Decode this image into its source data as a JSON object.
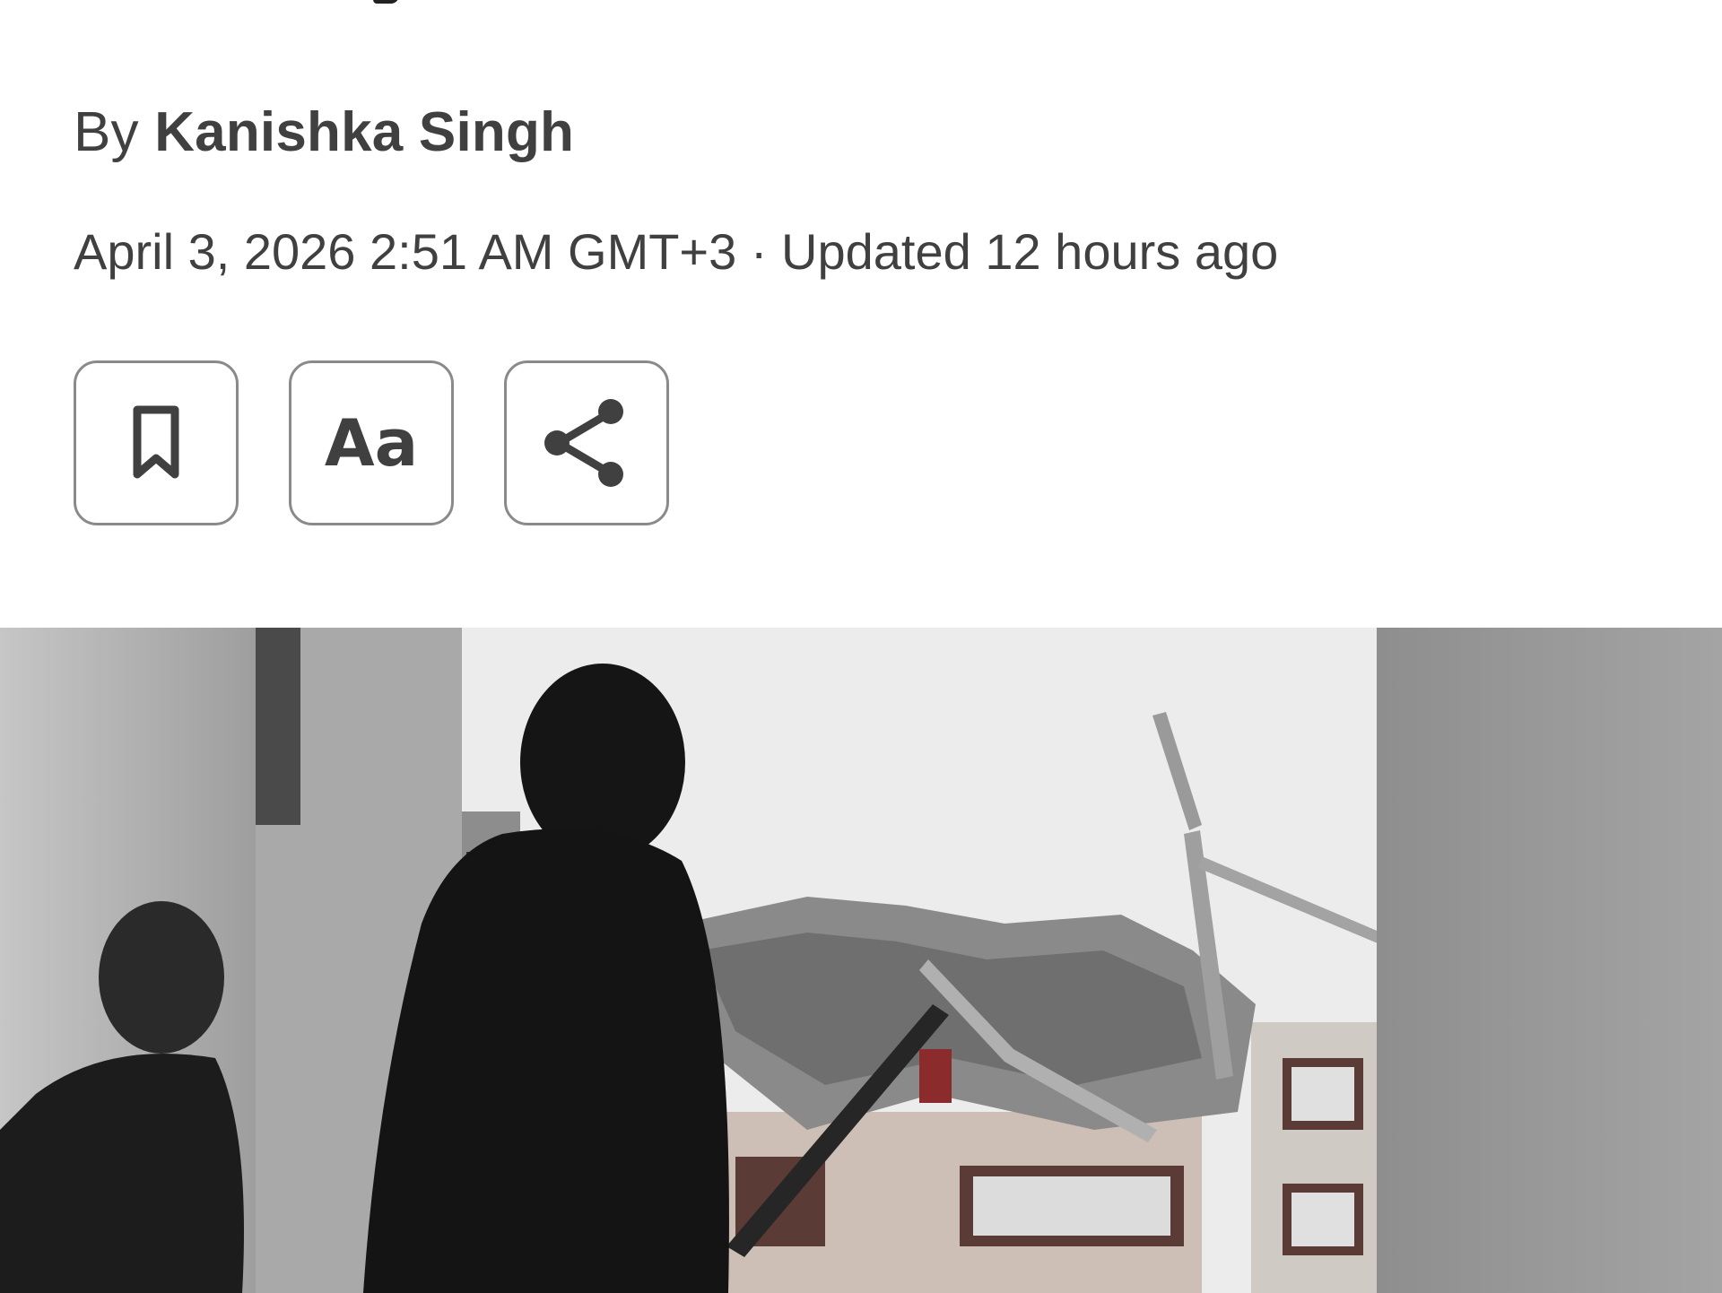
{
  "article": {
    "byline_prefix": "By",
    "author": "Kanishka Singh",
    "published": "April 3, 2026 2:51 AM GMT+3",
    "separator": "·",
    "updated": "Updated 12 hours ago"
  },
  "toolbar": {
    "bookmark_icon": "bookmark-icon",
    "text_size_label": "Aa",
    "share_icon": "share-icon"
  },
  "hero_image": {
    "subject": "damaged-building-photo"
  },
  "colors": {
    "text": "#404040",
    "button_border": "#8a8a8a"
  }
}
